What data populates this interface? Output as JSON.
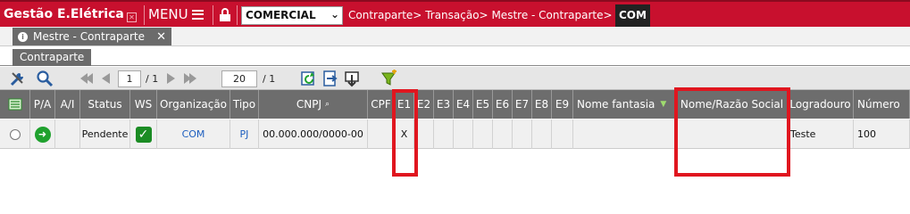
{
  "header": {
    "app_name": "Gestão E.Elétrica",
    "menu_label": "MENU",
    "company_select": "COMERCIAL",
    "breadcrumb": [
      "Contraparte>",
      "Transação>",
      "Mestre - Contraparte>"
    ],
    "breadcrumb_current": "COM",
    "accent_color": "#c8102e"
  },
  "tabs": [
    {
      "label": "Mestre - Contraparte",
      "close": "✕"
    }
  ],
  "subtab": "Contraparte",
  "toolbar": {
    "page_current": "1",
    "page_total": "/ 1",
    "page_size": "20",
    "size_total": "/ 1"
  },
  "grid": {
    "columns": [
      "",
      "P/A",
      "A/I",
      "Status",
      "WS",
      "Organização",
      "Tipo",
      "CNPJ",
      "CPF",
      "E1",
      "E2",
      "E3",
      "E4",
      "E5",
      "E6",
      "E7",
      "E8",
      "E9",
      "Nome fantasia",
      "Nome/Razão Social",
      "Logradouro",
      "Número"
    ],
    "rows": [
      {
        "status": "Pendente",
        "organizacao": "COM",
        "tipo": "PJ",
        "cnpj": "00.000.000/0000-00",
        "cpf": "",
        "e1": "X",
        "nome_fantasia": "",
        "razao_social": "",
        "logradouro": "Teste",
        "numero": "100"
      }
    ]
  },
  "highlight_color": "#e0161f"
}
